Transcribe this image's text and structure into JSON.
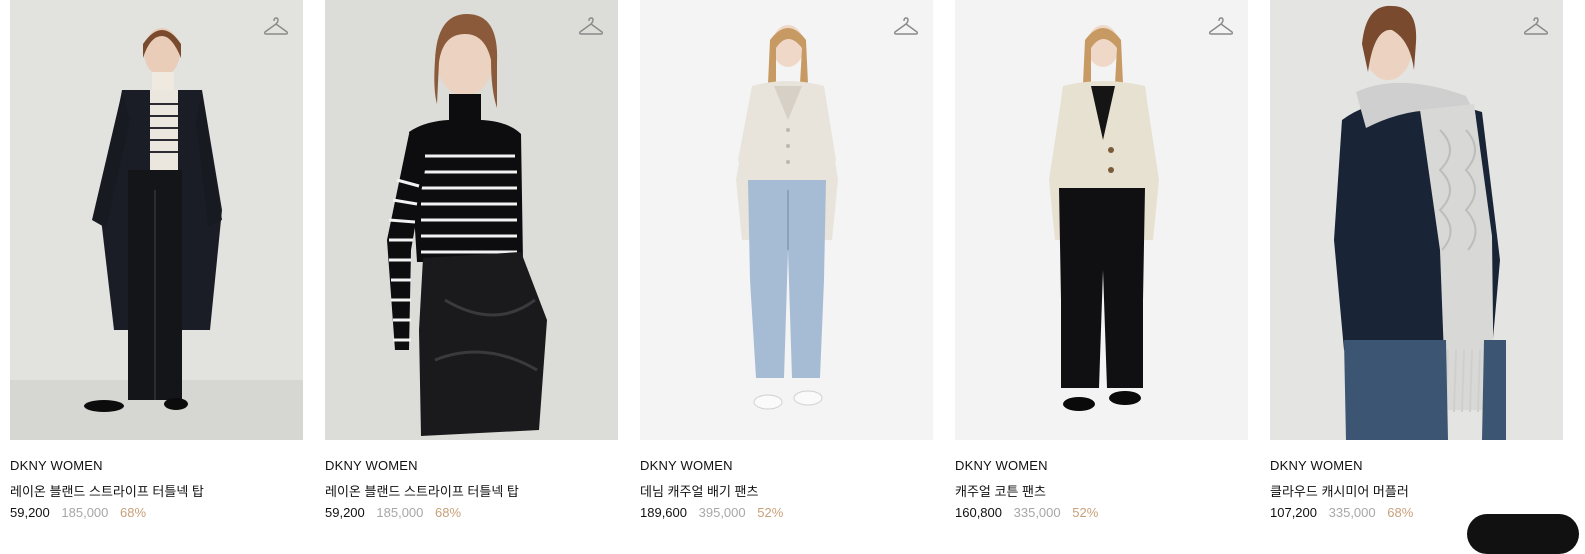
{
  "products": [
    {
      "brand": "DKNY WOMEN",
      "title": "레이온 블랜드 스트라이프 터틀넥 탑",
      "price": "59,200",
      "original_price": "185,000",
      "discount": "68%",
      "bg": "#e2e2df"
    },
    {
      "brand": "DKNY WOMEN",
      "title": "레이온 블랜드 스트라이프 터틀넥 탑",
      "price": "59,200",
      "original_price": "185,000",
      "discount": "68%",
      "bg": "#dcdcd8"
    },
    {
      "brand": "DKNY WOMEN",
      "title": "데님 캐주얼 배기 팬츠",
      "price": "189,600",
      "original_price": "395,000",
      "discount": "52%",
      "bg": "#f4f4f4"
    },
    {
      "brand": "DKNY WOMEN",
      "title": "캐주얼 코튼 팬츠",
      "price": "160,800",
      "original_price": "335,000",
      "discount": "52%",
      "bg": "#f3f3f3"
    },
    {
      "brand": "DKNY WOMEN",
      "title": "클라우드 캐시미어 머플러",
      "price": "107,200",
      "original_price": "335,000",
      "discount": "68%",
      "bg": "#e4e4e2"
    }
  ],
  "icons": {
    "wishlist": "hanger-icon"
  }
}
